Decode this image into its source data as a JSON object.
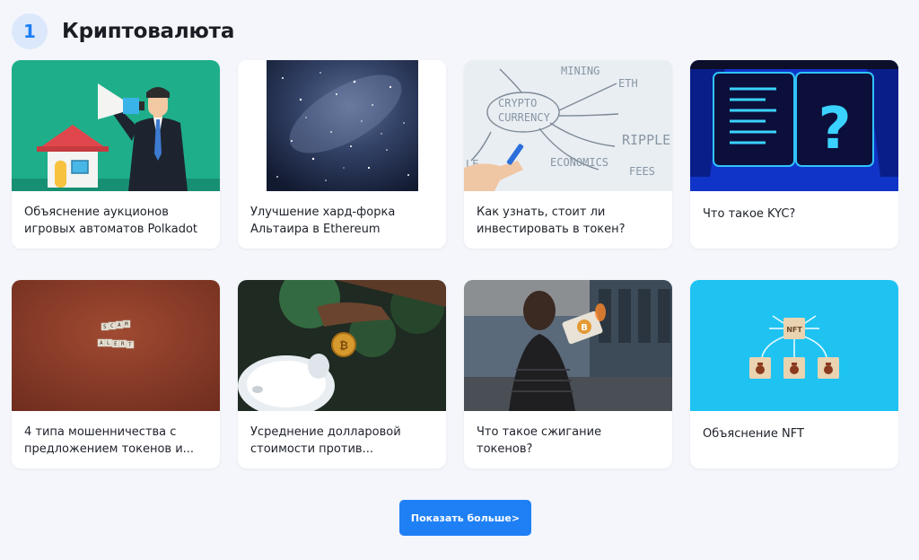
{
  "section": {
    "number": "1",
    "title": "Криптовалюта"
  },
  "cards": [
    {
      "title": "Объяснение аукционов игровых автоматов Polkadot",
      "image": "megaphone-businessman-illustration"
    },
    {
      "title": "Улучшение хард-форка Альтаира в Ethereum",
      "image": "starry-sky-photo"
    },
    {
      "title": "Как узнать, стоит ли инвестировать в токен?",
      "image": "crypto-whiteboard-photo"
    },
    {
      "title": "Что такое KYC?",
      "image": "kyc-question-illustration"
    },
    {
      "title": "4 типа мошенничества с предложением токенов и...",
      "image": "scam-alert-tiles-photo"
    },
    {
      "title": "Усреднение долларовой стоимости против...",
      "image": "piggy-bank-coin-photo"
    },
    {
      "title": "Что такое сжигание токенов?",
      "image": "burning-bitcoin-photo"
    },
    {
      "title": "Объяснение NFT",
      "image": "nft-blocks-photo"
    }
  ],
  "show_more_label": "Показать больше>",
  "colors": {
    "accent": "#1f80f5",
    "badge_bg": "#dbe8fb",
    "page_bg": "#f4f6fb"
  }
}
